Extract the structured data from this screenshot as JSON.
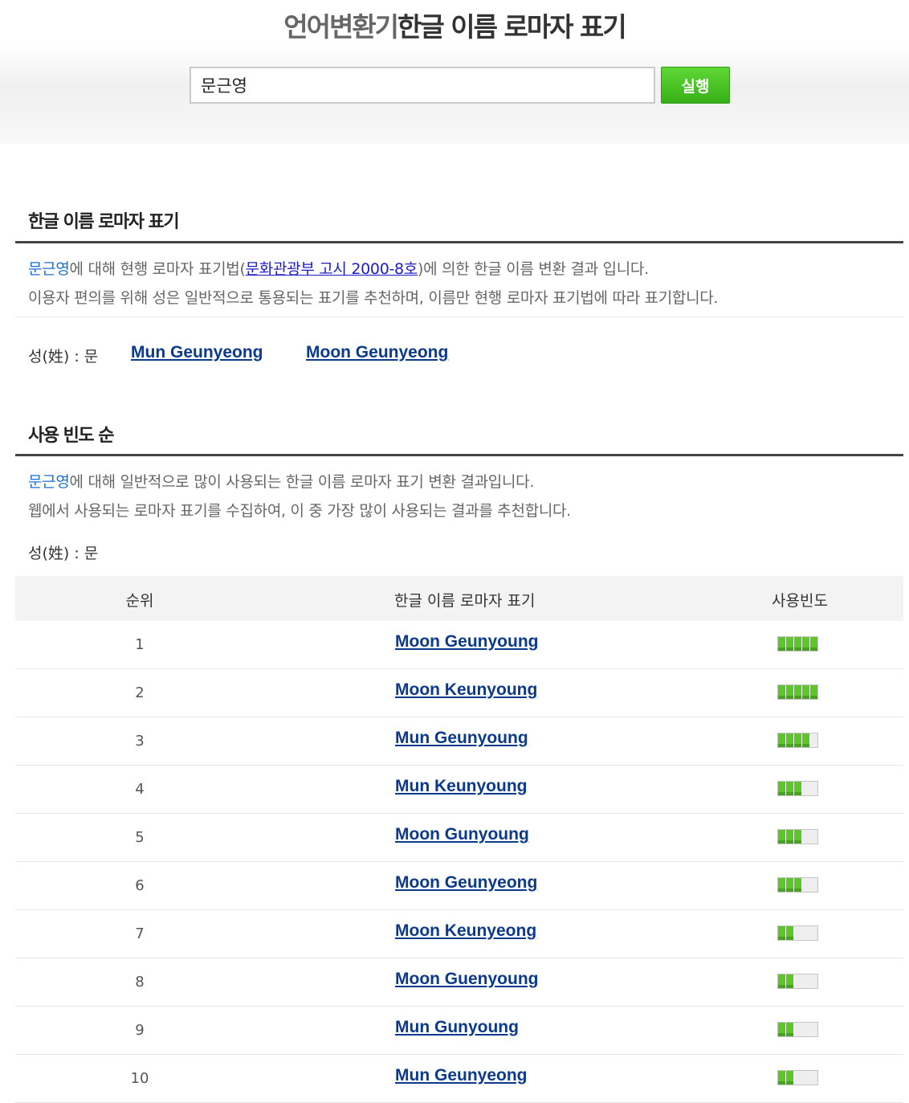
{
  "header": {
    "title_part1": "언어변환기",
    "title_part2": "한글 이름 로마자 표기",
    "search_value": "문근영",
    "run_label": "실행"
  },
  "section1": {
    "title": "한글 이름 로마자 표기",
    "name": "문근영",
    "line1_a": "에 대해 현행 로마자 표기법(",
    "law_link": "문화관광부 고시 2000-8호",
    "line1_b": ")에 의한 한글 이름 변환 결과 입니다.",
    "line2": "이용자 편의를 위해 성은 일반적으로 통용되는 표기를 추천하며, 이름만 현행 로마자 표기법에 따라 표기합니다.",
    "surname_label": "성(姓) : 문",
    "results": [
      "Mun Geunyeong",
      "Moon Geunyeong"
    ]
  },
  "section2": {
    "title": "사용 빈도 순",
    "name": "문근영",
    "line1": "에 대해 일반적으로 많이 사용되는 한글 이름 로마자 표기 변환 결과입니다.",
    "line2": "웹에서 사용되는 로마자 표기를 수집하여, 이 중 가장 많이 사용되는 결과를 추천합니다.",
    "surname_label": "성(姓) : 문",
    "columns": [
      "순위",
      "한글 이름 로마자 표기",
      "사용빈도"
    ],
    "rows": [
      {
        "rank": "1",
        "name": "Moon Geunyoung",
        "frequency": 5
      },
      {
        "rank": "2",
        "name": "Moon Keunyoung",
        "frequency": 5
      },
      {
        "rank": "3",
        "name": "Mun Geunyoung",
        "frequency": 4
      },
      {
        "rank": "4",
        "name": "Mun Keunyoung",
        "frequency": 3
      },
      {
        "rank": "5",
        "name": "Moon Gunyoung",
        "frequency": 3
      },
      {
        "rank": "6",
        "name": "Moon Geunyeong",
        "frequency": 3
      },
      {
        "rank": "7",
        "name": "Moon Keunyeong",
        "frequency": 2
      },
      {
        "rank": "8",
        "name": "Moon Guenyoung",
        "frequency": 2
      },
      {
        "rank": "9",
        "name": "Mun Gunyoung",
        "frequency": 2
      },
      {
        "rank": "10",
        "name": "Mun Geunyeong",
        "frequency": 2
      }
    ],
    "frequency_max": 5,
    "bar_on_color": "#5ec62b"
  }
}
